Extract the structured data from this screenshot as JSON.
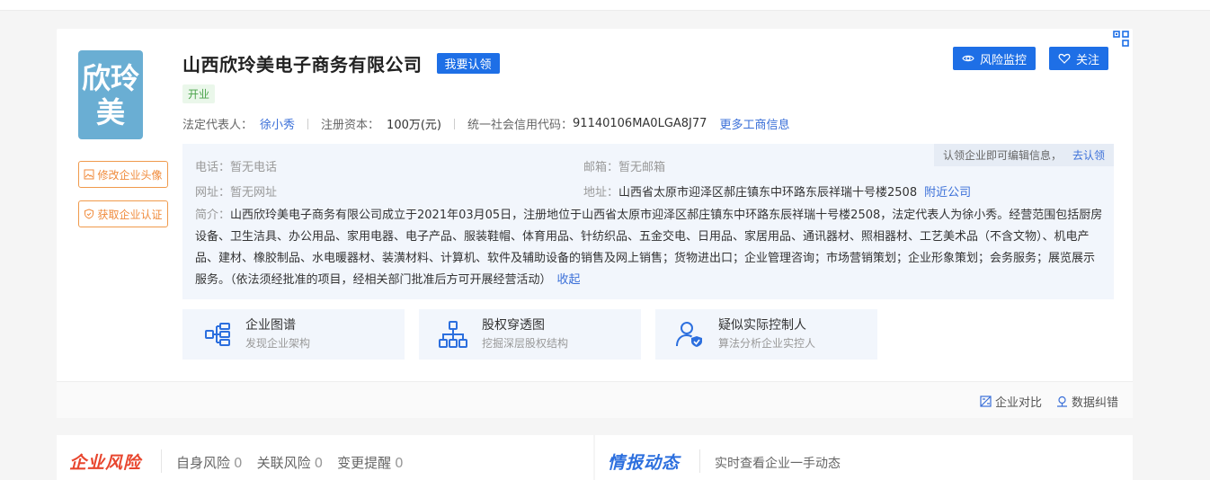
{
  "company": {
    "logo_text": "欣玲美",
    "name": "山西欣玲美电子商务有限公司",
    "claim_label": "我要认领",
    "status": "开业"
  },
  "side_buttons": {
    "edit_avatar": "修改企业头像",
    "get_cert": "获取企业认证"
  },
  "actions": {
    "risk_monitor": "风险监控",
    "follow": "关注"
  },
  "basic": {
    "legal_rep_label": "法定代表人：",
    "legal_rep": "徐小秀",
    "capital_label": "注册资本：",
    "capital": "100万(元)",
    "credit_code_label": "统一社会信用代码：",
    "credit_code": "91140106MA0LGA8J77",
    "more_link": "更多工商信息"
  },
  "contact": {
    "claim_hint": "认领企业即可编辑信息，",
    "claim_link": "去认领",
    "phone_label": "电话：",
    "phone": "暂无电话",
    "email_label": "邮箱：",
    "email": "暂无邮箱",
    "website_label": "网址：",
    "website": "暂无网址",
    "address_label": "地址：",
    "address": "山西省太原市迎泽区郝庄镇东中环路东辰祥瑞十号楼2508",
    "nearby_link": "附近公司",
    "intro_label": "简介：",
    "intro": "山西欣玲美电子商务有限公司成立于2021年03月05日，注册地位于山西省太原市迎泽区郝庄镇东中环路东辰祥瑞十号楼2508，法定代表人为徐小秀。经营范围包括厨房设备、卫生洁具、办公用品、家用电器、电子产品、服装鞋帽、体育用品、针纺织品、五金交电、日用品、家居用品、通讯器材、照相器材、工艺美术品（不含文物）、机电产品、建材、橡胶制品、水电暖器材、装潢材料、计算机、软件及辅助设备的销售及网上销售；货物进出口；企业管理咨询；市场营销策划；企业形象策划；会务服务；展览展示服务。（依法须经批准的项目，经相关部门批准后方可开展经营活动）",
    "collapse_link": "收起"
  },
  "features": [
    {
      "title": "企业图谱",
      "sub": "发现企业架构"
    },
    {
      "title": "股权穿透图",
      "sub": "挖掘深层股权结构"
    },
    {
      "title": "疑似实际控制人",
      "sub": "算法分析企业实控人"
    }
  ],
  "footer": {
    "compare": "企业对比",
    "correct": "数据纠错"
  },
  "risk": {
    "title": "企业风险",
    "self_label": "自身风险",
    "self_count": "0",
    "related_label": "关联风险",
    "related_count": "0",
    "change_label": "变更提醒",
    "change_count": "0"
  },
  "dynamics": {
    "title": "情报动态",
    "sub": "实时查看企业一手动态"
  }
}
